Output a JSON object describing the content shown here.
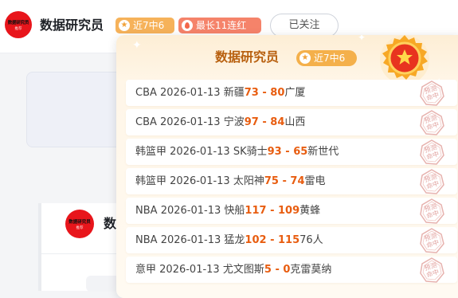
{
  "header": {
    "avatar_line1": "数据研究员",
    "avatar_line2": "推荐",
    "name": "数据研究员",
    "badge_recent": "近7中6",
    "badge_streak": "最长11连红",
    "follow_label": "已关注"
  },
  "background": {
    "avatar_line1": "数据研究员",
    "avatar_line2": "推荐",
    "name_partial": "数"
  },
  "popover": {
    "title": "数据研究员",
    "badge_recent": "近7中6",
    "medal_icon": "star-medal",
    "stamp_text": "预测命中",
    "records": [
      {
        "league": "CBA",
        "date": "2026-01-13",
        "home": "新疆",
        "home_score": "73",
        "sep": " - ",
        "away_score": "80",
        "away": "广厦"
      },
      {
        "league": "CBA",
        "date": "2026-01-13",
        "home": "宁波",
        "home_score": "97",
        "sep": " - ",
        "away_score": "84",
        "away": "山西"
      },
      {
        "league": "韩篮甲",
        "date": "2026-01-13",
        "home": "SK骑士",
        "home_score": "93",
        "sep": " - ",
        "away_score": "65",
        "away": "新世代"
      },
      {
        "league": "韩篮甲",
        "date": "2026-01-13",
        "home": "太阳神",
        "home_score": "75",
        "sep": " - ",
        "away_score": "74",
        "away": "雷电"
      },
      {
        "league": "NBA",
        "date": "2026-01-13",
        "home": "快船",
        "home_score": "117",
        "sep": " - ",
        "away_score": "109",
        "away": "黄蜂"
      },
      {
        "league": "NBA",
        "date": "2026-01-13",
        "home": "猛龙",
        "home_score": "102",
        "sep": " - ",
        "away_score": "115",
        "away": "76人"
      },
      {
        "league": "意甲",
        "date": "2026-01-13",
        "home": "尤文图斯",
        "home_score": "5",
        "sep": " - ",
        "away_score": "0",
        "away": "克雷莫纳"
      }
    ]
  },
  "colors": {
    "accent_orange": "#e85d10",
    "title_brown": "#b8600f",
    "badge_gold": "#f6b25a",
    "badge_coral": "#f5836a",
    "avatar_red": "#e8151b"
  }
}
